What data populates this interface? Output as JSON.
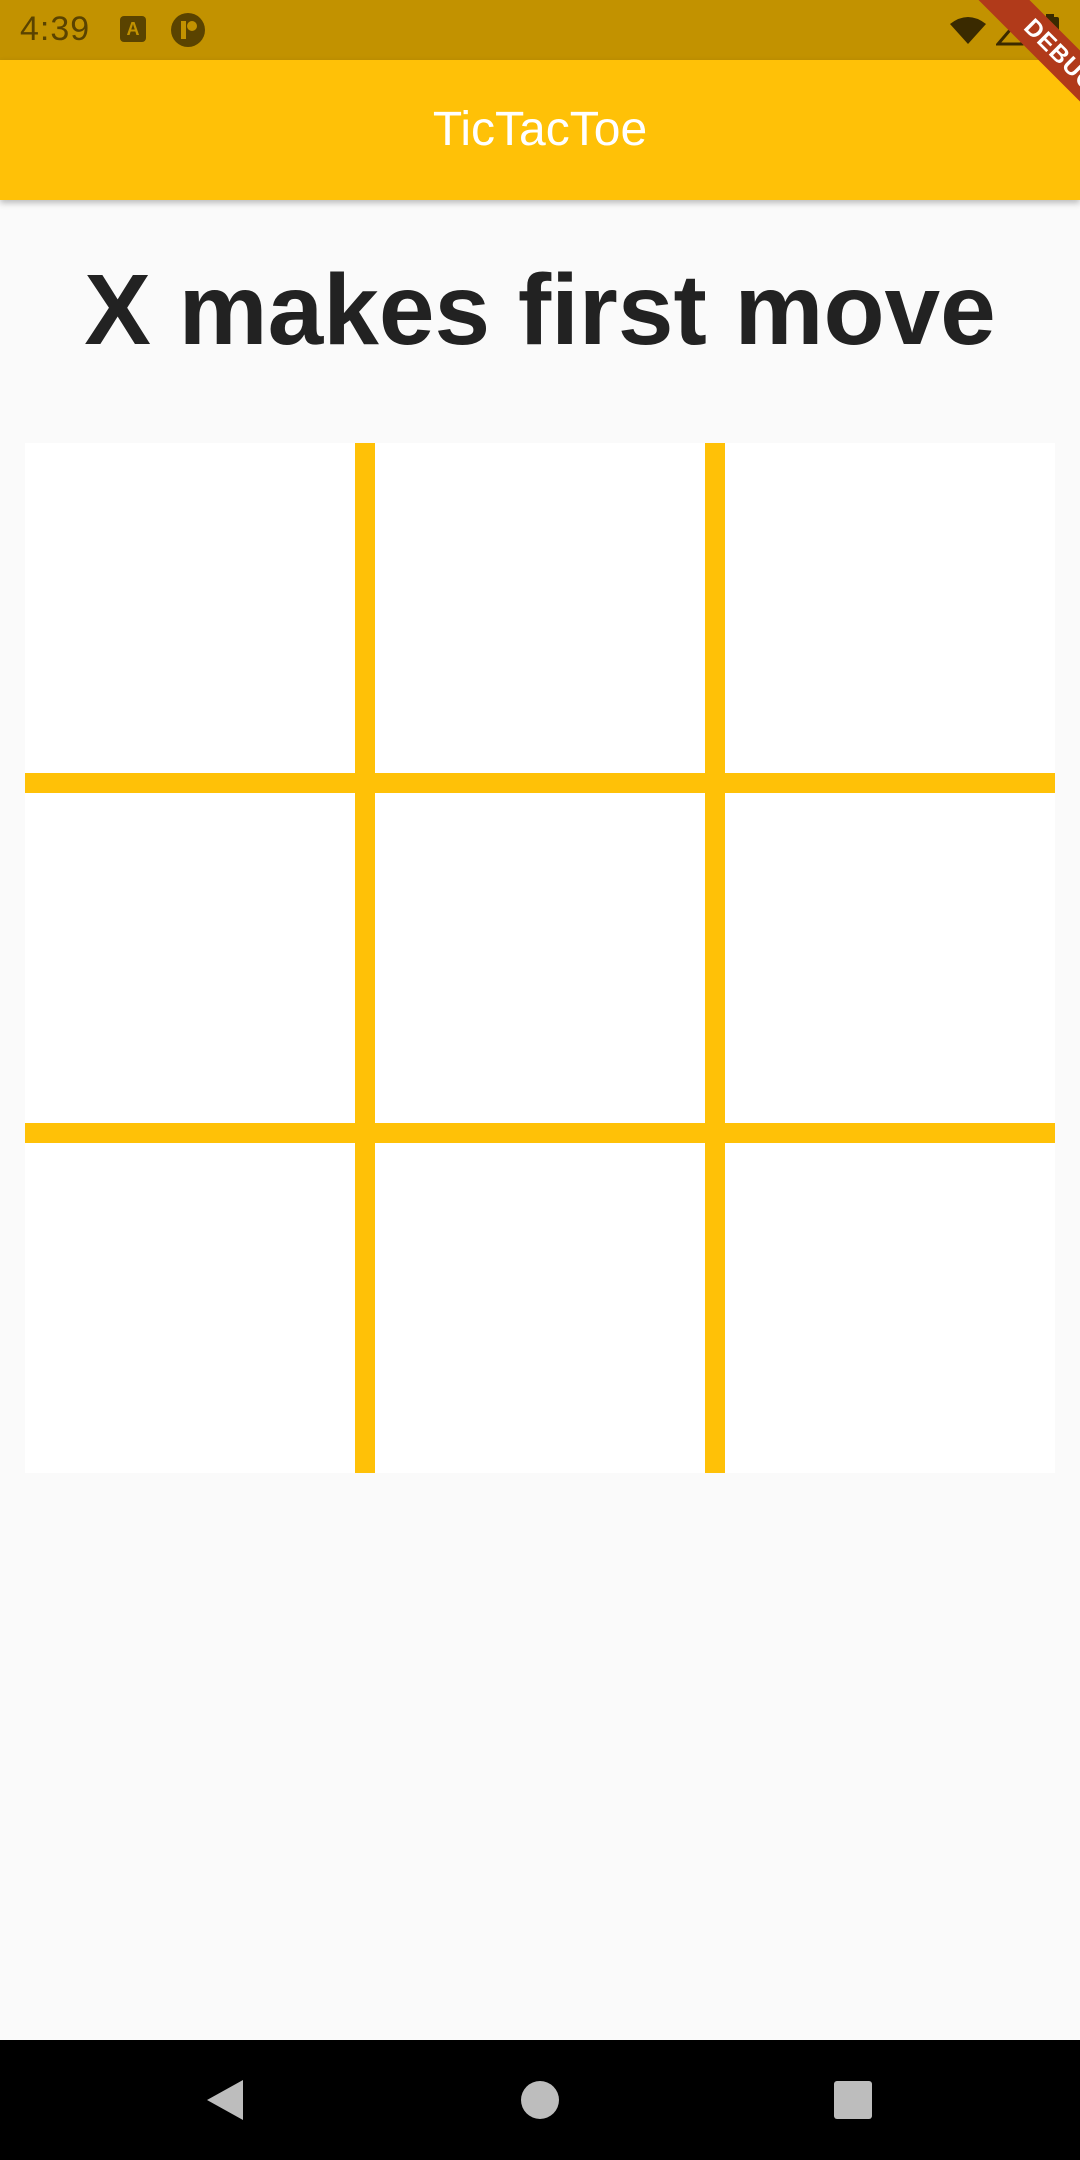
{
  "status_bar": {
    "time": "4:39",
    "icons": [
      "a-icon",
      "p-icon",
      "wifi-icon",
      "signal-icon",
      "battery-icon"
    ],
    "a_icon_text": "A"
  },
  "app_bar": {
    "title": "TicTacToe",
    "color": "#ffc107"
  },
  "debug_banner": {
    "label": "DEBUG",
    "color": "#b13a1a"
  },
  "game": {
    "status_text": "X makes first move",
    "grid_color": "#ffc107",
    "cells": [
      [
        "",
        "",
        ""
      ],
      [
        "",
        "",
        ""
      ],
      [
        "",
        "",
        ""
      ]
    ]
  },
  "nav_bar": {
    "icons": [
      "back-icon",
      "home-icon",
      "recents-icon"
    ]
  }
}
